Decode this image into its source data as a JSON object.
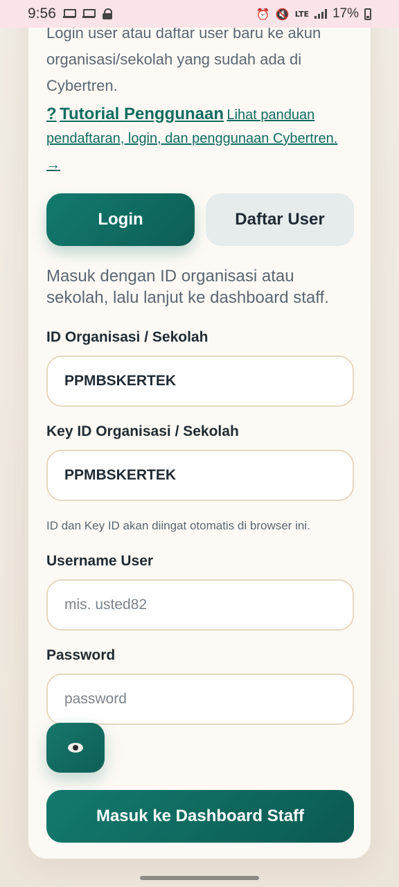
{
  "status_bar": {
    "time": "9:56",
    "battery": "17%",
    "network": "LTE",
    "icons": [
      "screen-mirror-icon",
      "screen-mirror-icon",
      "lock-icon",
      "alarm-icon",
      "mute-icon",
      "signal-icon",
      "battery-icon"
    ]
  },
  "intro": {
    "text": "Login user atau daftar user baru ke akun organisasi/sekolah yang sudah ada di Cybertren."
  },
  "tutorial": {
    "prefix": "?",
    "title": "Tutorial Penggunaan",
    "description": "Lihat panduan pendaftaran, login, dan penggunaan Cybertren.",
    "arrow": "→"
  },
  "tabs": {
    "login": "Login",
    "register": "Daftar User"
  },
  "subtitle": "Masuk dengan ID organisasi atau sekolah, lalu lanjut ke dashboard staff.",
  "form": {
    "org_id_label": "ID Organisasi / Sekolah",
    "org_id_value": "PPMBSKERTEK",
    "key_id_label": "Key ID Organisasi / Sekolah",
    "key_id_value": "PPMBSKERTEK",
    "hint": "ID dan Key ID akan diingat otomatis di browser ini.",
    "username_label": "Username User",
    "username_placeholder": "mis. usted82",
    "password_label": "Password",
    "password_placeholder": "password",
    "submit_label": "Masuk ke Dashboard Staff"
  },
  "colors": {
    "primary": "#0f6b5f",
    "input_border": "#e6d8bf",
    "secondary_button": "#e6ebec",
    "status_bar": "#fbe3ea"
  }
}
